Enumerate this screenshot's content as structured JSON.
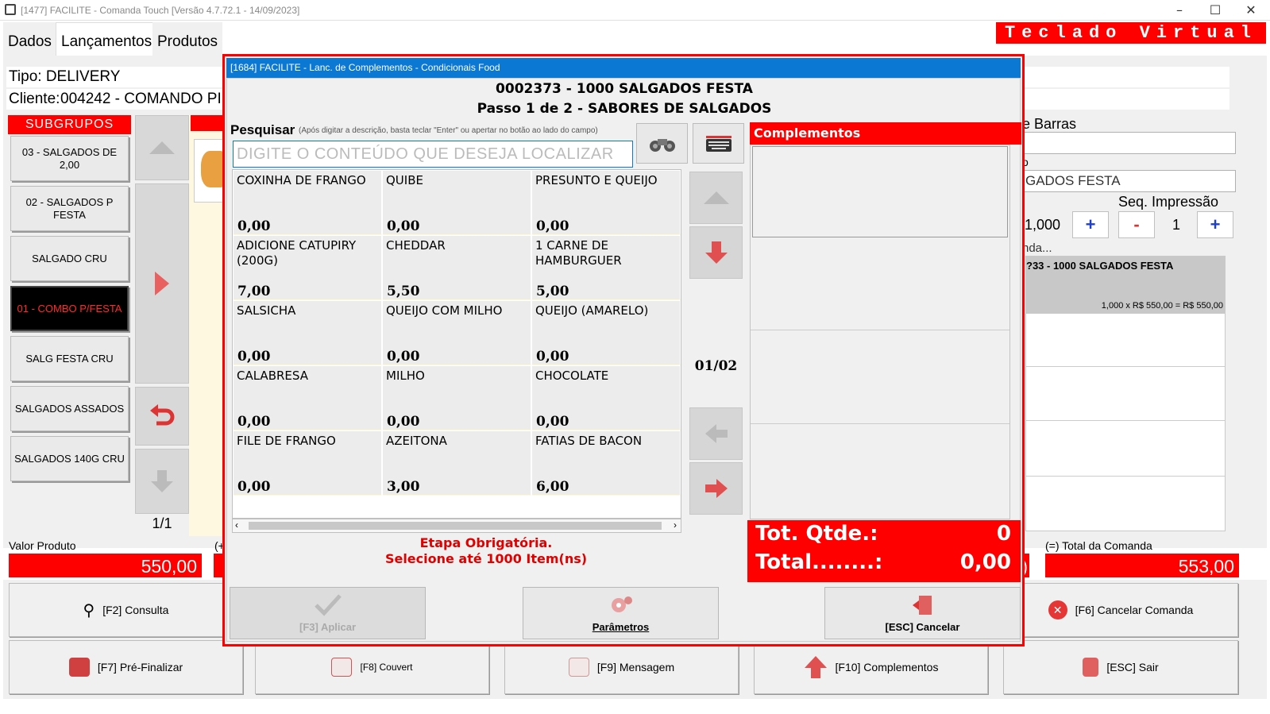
{
  "window": {
    "title": "[1477] FACILITE - Comanda Touch [Versão 4.7.72.1 - 14/09/2023]",
    "minimize": "–",
    "maximize": "☐",
    "close": "✕"
  },
  "tabs": [
    {
      "label": "Dados"
    },
    {
      "label": "Lançamentos"
    },
    {
      "label": "Produtos"
    }
  ],
  "teclado_label": "Teclado  Virtual",
  "order": {
    "tipo": "Tipo: DELIVERY",
    "cliente_label": "Cliente:",
    "cliente_value": "004242 -    COMANDO PI"
  },
  "subgrupos": {
    "header": "SUBGRUPOS",
    "items": [
      "03 - SALGADOS DE 2,00",
      "02 - SALGADOS P FESTA",
      "SALGADO CRU",
      "01 - COMBO P/FESTA",
      "SALG FESTA CRU",
      "SALGADOS ASSADOS",
      "SALGADOS 140G CRU"
    ],
    "selected": "01 - COMBO P/FESTA"
  },
  "left_page": "1/1",
  "right_panel": {
    "barras_label": "e Barras",
    "barras_value": "",
    "prod_label": "o",
    "prod_value": "GADOS FESTA",
    "seq_label": "Seq. Impressão",
    "qty_value": "1,000",
    "seq_value": "1",
    "plus": "+",
    "minus": "-",
    "comanda_label": "nda...",
    "comanda_item_title": "?33 - 1000 SALGADOS FESTA",
    "comanda_item_detail": "1,000 x R$ 550,00 = R$ 550,00"
  },
  "values": {
    "valor_produto_label": "Valor Produto",
    "valor_produto": "550,00",
    "plus_label": "(+",
    "total_comanda_label": "(=) Total da Comanda",
    "total_comanda": "553,00",
    "partial": ")"
  },
  "bottom_buttons": {
    "row1": [
      "[F2] Consulta",
      "[F6] Cancelar Comanda"
    ],
    "row2": [
      "[F7] Pré-Finalizar",
      "[F8] Couvert",
      "[F9] Mensagem",
      "[F10] Complementos",
      "[ESC] Sair"
    ]
  },
  "dialog": {
    "title": "[1684] FACILITE - Lanc. de Complementos - Condicionais Food",
    "product": "0002373 - 1000 SALGADOS FESTA",
    "step": "Passo 1 de 2 - SABORES DE SALGADOS",
    "search_label": "Pesquisar",
    "search_hint": "(Após digitar a descrição, basta teclar \"Enter\" ou apertar no botão ao lado do campo)",
    "search_placeholder": "DIGITE O CONTEÚDO QUE DESEJA LOCALIZAR",
    "items": [
      {
        "name": "COXINHA DE FRANGO",
        "price": "0,00"
      },
      {
        "name": "QUIBE",
        "price": "0,00"
      },
      {
        "name": "PRESUNTO E QUEIJO",
        "price": "0,00"
      },
      {
        "name": "ADICIONE CATUPIRY (200G)",
        "price": "7,00"
      },
      {
        "name": "CHEDDAR",
        "price": "5,50"
      },
      {
        "name": "1 CARNE DE HAMBURGUER",
        "price": "5,00"
      },
      {
        "name": "SALSICHA",
        "price": "0,00"
      },
      {
        "name": "QUEIJO COM MILHO",
        "price": "0,00"
      },
      {
        "name": "QUEIJO (AMARELO)",
        "price": "0,00"
      },
      {
        "name": "CALABRESA",
        "price": "0,00"
      },
      {
        "name": "MILHO",
        "price": "0,00"
      },
      {
        "name": "CHOCOLATE",
        "price": "0,00"
      },
      {
        "name": "FILE DE FRANGO",
        "price": "0,00"
      },
      {
        "name": "AZEITONA",
        "price": "3,00"
      },
      {
        "name": "FATIAS DE BACON",
        "price": "6,00"
      }
    ],
    "page_indicator": "01/02",
    "complementos_header": "Complementos",
    "message_line1": "Etapa Obrigatória.",
    "message_line2": "Selecione até 1000 Item(ns)",
    "tot_qtde_label": "Tot. Qtde.:",
    "tot_qtde_value": "0",
    "total_label": "Total........:",
    "total_value": "0,00",
    "apply_label": "[F3] Aplicar",
    "params_label": "Parâmetros",
    "cancel_label": "[ESC] Cancelar"
  }
}
